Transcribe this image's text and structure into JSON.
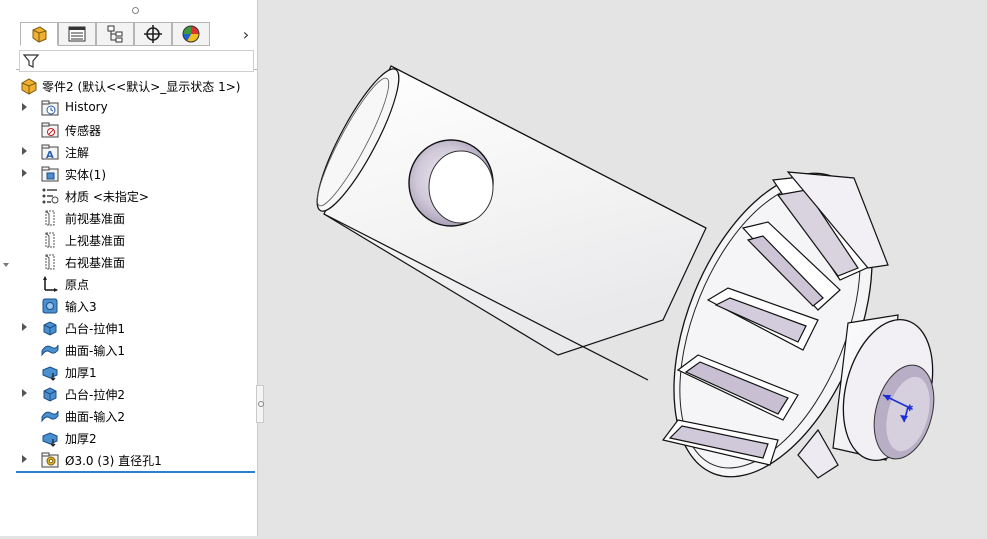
{
  "tabs": [
    {
      "name": "feature-manager",
      "active": true
    },
    {
      "name": "property-manager"
    },
    {
      "name": "configuration-manager"
    },
    {
      "name": "dimxpert-manager"
    },
    {
      "name": "display-manager"
    }
  ],
  "tab_more": "›",
  "tree": {
    "root": {
      "label": "零件2  (默认<<默认>_显示状态 1>)"
    },
    "items": [
      {
        "label": "History",
        "icon": "history-folder-icon",
        "expandable": true
      },
      {
        "label": "传感器",
        "icon": "sensors-folder-icon",
        "expandable": false
      },
      {
        "label": "注解",
        "icon": "annotations-folder-icon",
        "expandable": true
      },
      {
        "label": "实体(1)",
        "icon": "solid-bodies-folder-icon",
        "expandable": true
      },
      {
        "label": "材质 <未指定>",
        "icon": "material-icon",
        "expandable": false
      },
      {
        "label": "前视基准面",
        "icon": "plane-icon",
        "expandable": false
      },
      {
        "label": "上视基准面",
        "icon": "plane-icon",
        "expandable": false
      },
      {
        "label": "右视基准面",
        "icon": "plane-icon",
        "expandable": false
      },
      {
        "label": "原点",
        "icon": "origin-icon",
        "expandable": false
      },
      {
        "label": "输入3",
        "icon": "imported-body-icon",
        "expandable": false
      },
      {
        "label": "凸台-拉伸1",
        "icon": "boss-extrude-icon",
        "expandable": true
      },
      {
        "label": "曲面-输入1",
        "icon": "imported-surface-icon",
        "expandable": false
      },
      {
        "label": "加厚1",
        "icon": "thicken-icon",
        "expandable": false
      },
      {
        "label": "凸台-拉伸2",
        "icon": "boss-extrude-icon",
        "expandable": true
      },
      {
        "label": "曲面-输入2",
        "icon": "imported-surface-icon",
        "expandable": false
      },
      {
        "label": "加厚2",
        "icon": "thicken-icon",
        "expandable": false
      },
      {
        "label": "Ø3.0 (3) 直径孔1",
        "icon": "hole-wizard-icon",
        "expandable": true
      }
    ]
  },
  "colors": {
    "accent": "#2a7fd1",
    "viewport_bg": "#e4e4e4",
    "part": "#ffffff",
    "hole_interior": "#b8aec6"
  }
}
